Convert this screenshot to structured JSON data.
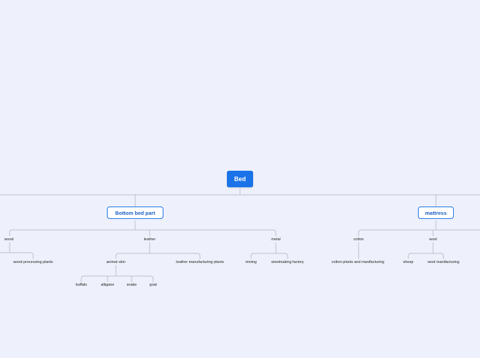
{
  "map": {
    "root": "Bed",
    "bottom": {
      "label": "Bottom bed part",
      "wood": {
        "label": "wood",
        "children": [
          "wood processing plants"
        ]
      },
      "leather": {
        "label": "leather",
        "animal_skin": {
          "label": "animal skin",
          "children": [
            "buffalo",
            "alligator",
            "snake",
            "goat"
          ]
        },
        "plants": "leather manufacturing plants"
      },
      "metal": {
        "label": "metal",
        "children": [
          "mining",
          "steelmaking factory"
        ]
      }
    },
    "mattress": {
      "label": "mattress",
      "cotton": {
        "label": "cotton",
        "children": [
          "cotton plants and manifacturing"
        ]
      },
      "wool": {
        "label": "wool",
        "children": [
          "sheep",
          "wool manifacturing"
        ]
      }
    }
  },
  "colors": {
    "background": "#eef1fb",
    "accent": "#1a73e8",
    "line": "#b9bec9"
  }
}
